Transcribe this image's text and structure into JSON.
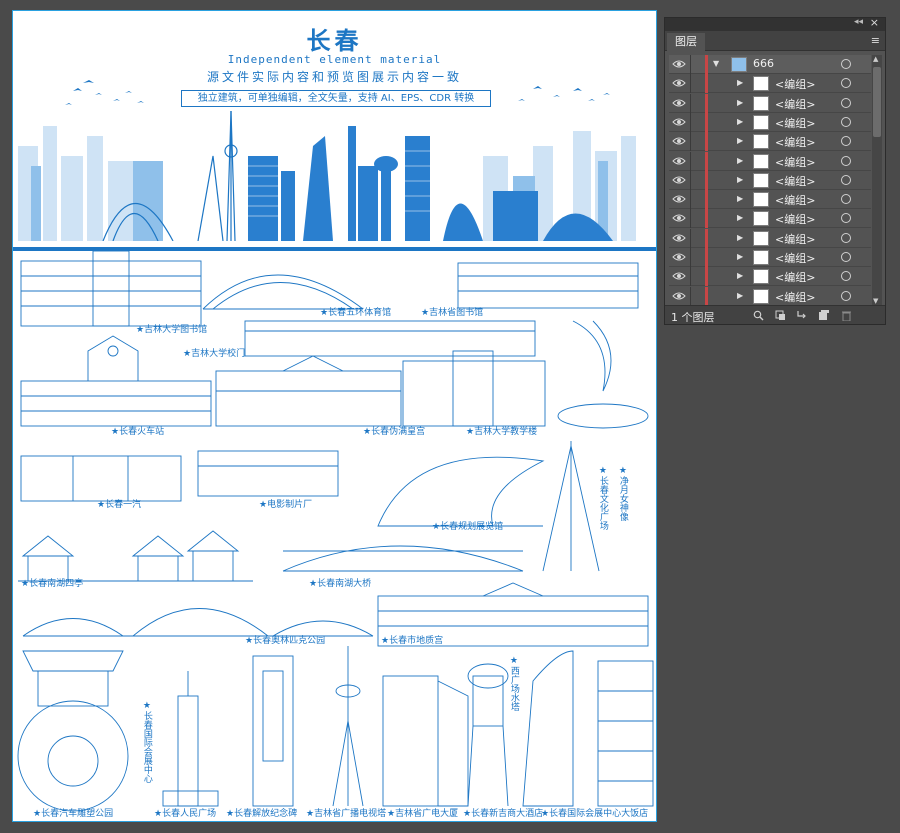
{
  "artboard": {
    "title": "长春",
    "subtitle": "Independent element material",
    "tagline": "源文件实际内容和预览图展示内容一致",
    "features": "独立建筑，可单独编辑，全文矢量，支持 AI、EPS、CDR 转换"
  },
  "buildings": {
    "library_jlu": "★吉林大学图书馆",
    "stadium_five_ring": "★长春五环体育馆",
    "library_jilin": "★吉林省图书馆",
    "gate_jlu": "★吉林大学校门",
    "station": "★长春火车站",
    "puppet_palace": "★长春伪满皇宫",
    "jlu_teaching": "★吉林大学教学楼",
    "faw": "★长春一汽",
    "film_studio": "★电影制片厂",
    "planning_hall": "★长春规划展览馆",
    "culture_square": "★长春文化广场",
    "moon_goddess": "★净月女神像",
    "nanhu_pavilions": "★长春南湖四亭",
    "nanhu_bridge": "★长春南湖大桥",
    "olympic_park": "★长春奥林匹克公园",
    "geology_palace": "★长春市地质宫",
    "west_tower": "★西广场水塔",
    "convention_center": "★长春国际会展中心",
    "sculpture_park": "★长春汽车雕塑公园",
    "people_square": "★长春人民广场",
    "liberation_memorial": "★长春解放纪念碑",
    "tv_tower": "★吉林省广播电视塔",
    "broadcast_building": "★吉林省广电大厦",
    "shangri_la": "★长春新吉商大酒店",
    "conv_hotel": "★长春国际会展中心大饭店"
  },
  "panel": {
    "tab": "图层",
    "layers": [
      {
        "name": "666",
        "expanded": true,
        "selected": true
      },
      {
        "name": "<编组>"
      },
      {
        "name": "<编组>"
      },
      {
        "name": "<编组>"
      },
      {
        "name": "<编组>"
      },
      {
        "name": "<编组>"
      },
      {
        "name": "<编组>"
      },
      {
        "name": "<编组>"
      },
      {
        "name": "<编组>"
      },
      {
        "name": "<编组>"
      },
      {
        "name": "<编组>"
      },
      {
        "name": "<编组>"
      },
      {
        "name": "<编组>"
      }
    ],
    "footer": "1 个图层"
  },
  "colors": {
    "accent": "#1d76c4",
    "light_accent": "#7fb7ea",
    "panel_bg": "#535353",
    "layer_color": "#c84646"
  },
  "icons": [
    "eye-icon",
    "disclosure-triangle-icon",
    "target-circle-icon",
    "search-icon",
    "clipping-mask-icon",
    "new-sublayer-icon",
    "new-layer-icon",
    "trash-icon",
    "panel-menu-icon",
    "close-icon",
    "collapse-icon"
  ]
}
